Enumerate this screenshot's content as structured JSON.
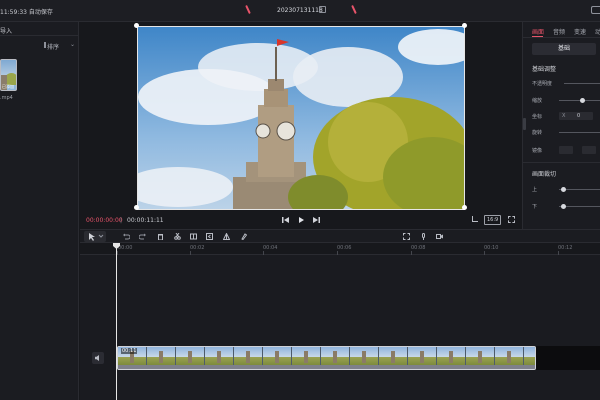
{
  "topbar": {
    "autosave": "11:59:33 自动保存",
    "project_title": "202307131118",
    "accent": "#e8546a"
  },
  "media": {
    "tab_label": "导入",
    "sort_label": "排序",
    "clip_label": "已添加",
    "file_name": ".mp4"
  },
  "player": {
    "current_time": "00:00:00:00",
    "total_time": "00:00:11:11",
    "aspect_ratio": "16:9"
  },
  "inspector": {
    "tabs": [
      "画面",
      "音频",
      "变速",
      "动"
    ],
    "active_tab": "画面",
    "basic_button": "基础",
    "section_basic": "基础调整",
    "opacity_label": "不透明度",
    "scale_label": "缩放",
    "position_label": "坐标",
    "position_value": "0",
    "rotate_label": "旋转",
    "mirror_label": "镜像",
    "section_crop": "画面裁切",
    "crop_top_label": "上",
    "crop_bottom_label": "下"
  },
  "timeline": {
    "ticks": [
      "00:00",
      "00:02",
      "00:04",
      "00:06",
      "00:08",
      "00:10",
      "00:12"
    ],
    "clip_duration": "00:11"
  }
}
